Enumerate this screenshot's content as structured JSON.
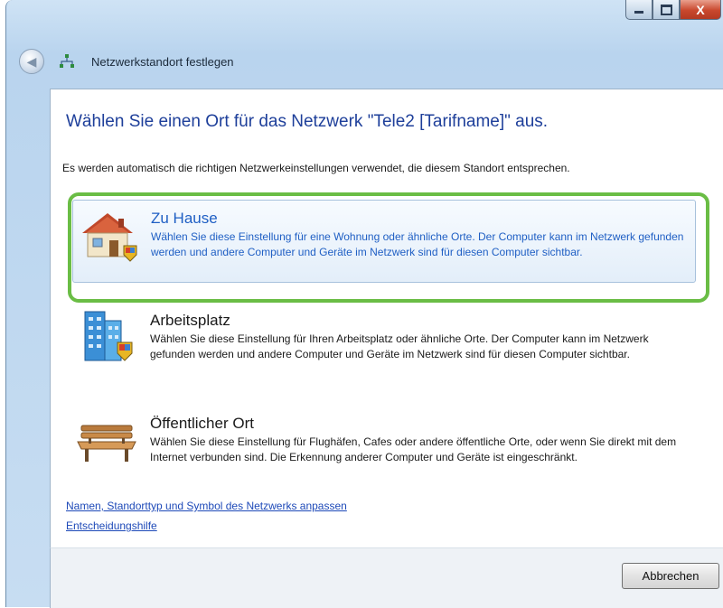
{
  "window": {
    "title": "Netzwerkstandort festlegen",
    "controls": {
      "close_label": "X"
    }
  },
  "heading": "Wählen Sie einen Ort für das Netzwerk \"Tele2 [Tarifname]\" aus.",
  "intro": "Es werden automatisch die richtigen Netzwerkeinstellungen verwendet, die diesem Standort entsprechen.",
  "options": [
    {
      "title": "Zu Hause",
      "description": "Wählen Sie diese Einstellung für eine Wohnung oder ähnliche Orte. Der Computer kann im Netzwerk gefunden werden und andere Computer und Geräte im Netzwerk sind für diesen Computer sichtbar.",
      "icon": "house-icon",
      "selected": true
    },
    {
      "title": "Arbeitsplatz",
      "description": "Wählen Sie diese Einstellung für Ihren Arbeitsplatz oder ähnliche Orte. Der Computer kann im Netzwerk gefunden werden und andere Computer und Geräte im Netzwerk sind für diesen Computer sichtbar.",
      "icon": "office-building-icon",
      "selected": false
    },
    {
      "title": "Öffentlicher Ort",
      "description": "Wählen Sie diese Einstellung für Flughäfen, Cafes oder andere öffentliche Orte, oder wenn Sie direkt mit dem Internet verbunden sind. Die Erkennung anderer Computer und Geräte ist eingeschränkt.",
      "icon": "park-bench-icon",
      "selected": false
    }
  ],
  "links": {
    "customize": "Namen, Standorttyp und Symbol des Netzwerks anpassen",
    "help": "Entscheidungshilfe"
  },
  "footer": {
    "cancel_label": "Abbrechen"
  },
  "colors": {
    "heading": "#1e3f9a",
    "selected_text": "#1f5fc4",
    "highlight_ring": "#6abd45",
    "link": "#1d49b8"
  }
}
